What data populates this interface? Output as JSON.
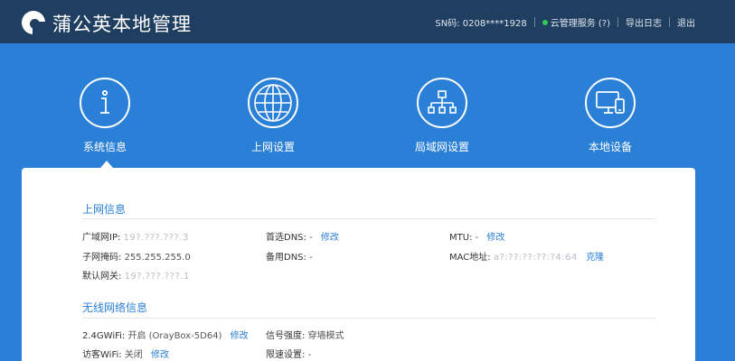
{
  "header": {
    "title": "蒲公英本地管理",
    "sn_label": "SN码: 0208****1928",
    "cloud_service": "云管理服务 (?)",
    "export_log": "导出日志",
    "logout": "退出",
    "status_color": "#34c759"
  },
  "nav": {
    "items": [
      {
        "label": "系统信息",
        "icon": "info-icon"
      },
      {
        "label": "上网设置",
        "icon": "globe-icon"
      },
      {
        "label": "局域网设置",
        "icon": "network-icon"
      },
      {
        "label": "本地设备",
        "icon": "devices-icon"
      }
    ],
    "active": "系统信息"
  },
  "internet": {
    "title": "上网信息",
    "wan_ip_label": "广域网IP:",
    "wan_ip_value": "19?.???.???.3",
    "mask_label": "子网掩码:",
    "mask_value": "255.255.255.0",
    "gateway_label": "默认网关:",
    "gateway_value": "19?.???.???.1",
    "dns1_label": "首选DNS:",
    "dns1_value": "-",
    "dns2_label": "备用DNS:",
    "dns2_value": "-",
    "mtu_label": "MTU:",
    "mtu_value": "-",
    "mac_label": "MAC地址:",
    "mac_value": "a?:??:??:??:?4:64",
    "clone": "克隆",
    "edit": "修改"
  },
  "wireless": {
    "title": "无线网络信息",
    "wifi24_label": "2.4GWiFi:",
    "wifi24_value": "开启 (OrayBox-5D64)",
    "guest_label": "访客WiFi:",
    "guest_value": "关闭",
    "signal_label": "信号强度:",
    "signal_value": "穿墙模式",
    "speed_label": "限速设置:",
    "speed_value": "-",
    "edit": "修改"
  },
  "colors": {
    "header_bg": "#1f3e60",
    "band_bg": "#2a7fd6",
    "accent": "#2a7fd6"
  }
}
